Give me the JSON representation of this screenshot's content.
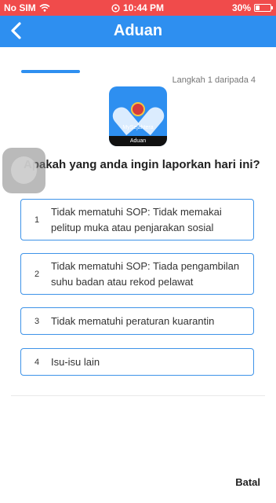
{
  "status_bar": {
    "carrier": "No SIM",
    "time": "10:44 PM",
    "battery": "30%",
    "battery_level": 0.3
  },
  "header": {
    "title": "Aduan"
  },
  "progress": {
    "step_text": "Langkah 1 daripada 4",
    "current": 1,
    "total": 4
  },
  "logo": {
    "app_name": "MySejahtera",
    "footer": "Aduan"
  },
  "question": "Apakah yang anda ingin laporkan hari ini?",
  "options": [
    {
      "number": "1",
      "label": "Tidak mematuhi SOP: Tidak memakai pelitup muka atau penjarakan sosial"
    },
    {
      "number": "2",
      "label": "Tidak mematuhi SOP: Tiada pengambilan suhu badan atau rekod pelawat"
    },
    {
      "number": "3",
      "label": "Tidak mematuhi peraturan kuarantin"
    },
    {
      "number": "4",
      "label": "Isu-isu lain"
    }
  ],
  "cancel_label": "Batal",
  "colors": {
    "status_bar": "#f04b4b",
    "header": "#2e8ff0",
    "option_border": "#3e93e8"
  }
}
